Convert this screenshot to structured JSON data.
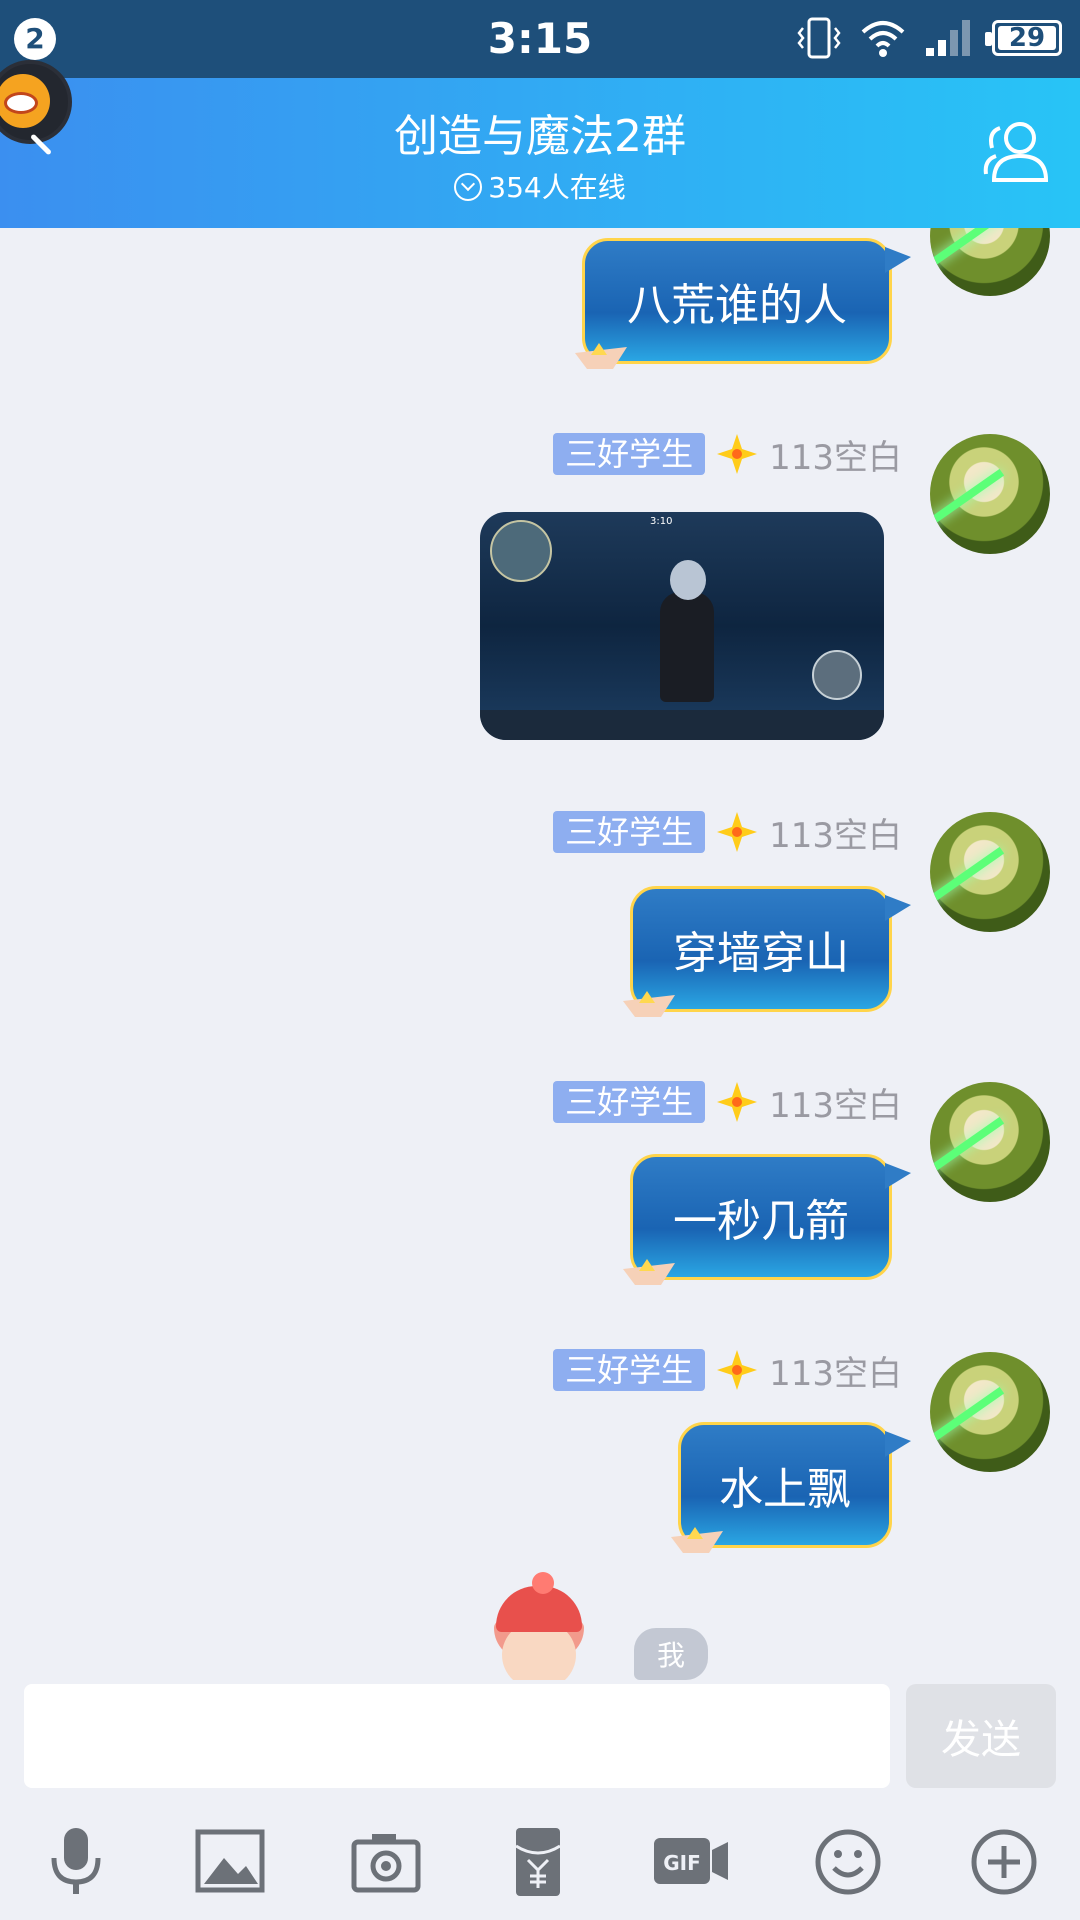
{
  "status_bar": {
    "notification_count": "2",
    "time": "3:15",
    "battery": "29"
  },
  "header": {
    "title": "创造与魔法2群",
    "online": "354人在线"
  },
  "messages": [
    {
      "type": "text",
      "text": "八荒谁的人"
    },
    {
      "type": "image",
      "badge": "三好学生",
      "name": "113空白",
      "image_clock": "3:10"
    },
    {
      "type": "text",
      "badge": "三好学生",
      "name": "113空白",
      "text": "穿墙穿山"
    },
    {
      "type": "text",
      "badge": "三好学生",
      "name": "113空白",
      "text": "一秒几箭"
    },
    {
      "type": "text",
      "badge": "三好学生",
      "name": "113空白",
      "text": "水上飘"
    }
  ],
  "me_label": "我",
  "input": {
    "value": "",
    "send_label": "发送"
  },
  "toolbar": {
    "icons": [
      "microphone-icon",
      "image-icon",
      "camera-icon",
      "red-packet-icon",
      "gif-icon",
      "emoji-icon",
      "plus-icon"
    ]
  },
  "colors": {
    "header_start": "#3b8ff0",
    "header_end": "#28c4f6",
    "badge": "#8eaef0",
    "bubble": "#1a64b3",
    "bubble_border": "#ffd44a"
  }
}
